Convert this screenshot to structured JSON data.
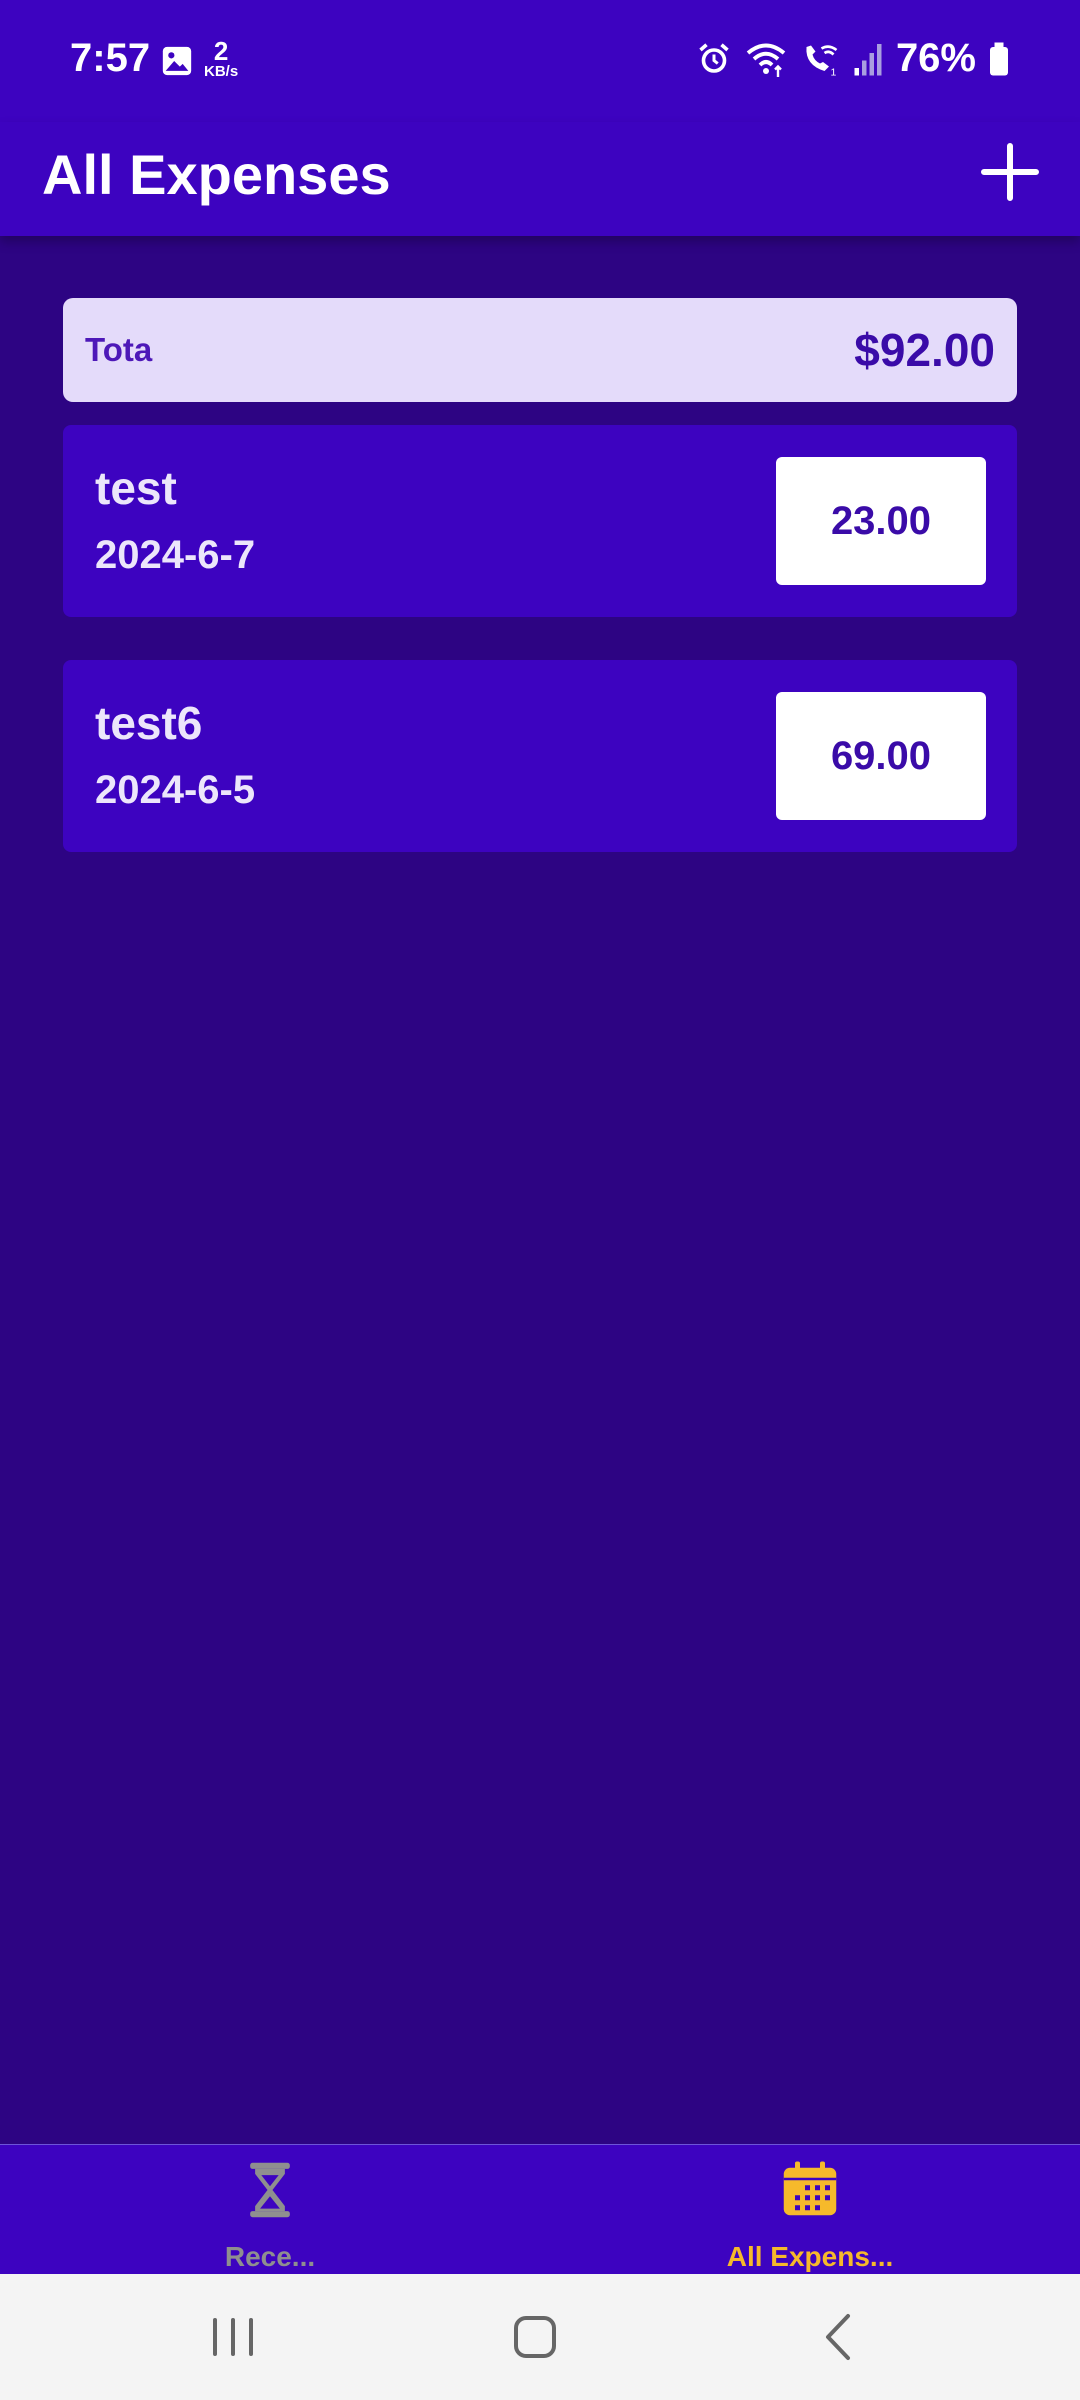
{
  "status_bar": {
    "time": "7:57",
    "net_speed_value": "2",
    "net_speed_unit": "KB/s",
    "battery": "76%",
    "icons": [
      "image-icon",
      "alarm-icon",
      "wifi-icon",
      "wifi-call-icon",
      "signal-icon",
      "battery-icon"
    ]
  },
  "app_bar": {
    "title": "All Expenses",
    "add_icon": "plus-icon"
  },
  "total": {
    "label": "Tota",
    "value": "$92.00"
  },
  "expenses": [
    {
      "title": "test",
      "date": "2024-6-7",
      "amount": "23.00"
    },
    {
      "title": "test6",
      "date": "2024-6-5",
      "amount": "69.00"
    }
  ],
  "bottom_nav": {
    "items": [
      {
        "label": "Rece...",
        "icon": "hourglass-icon",
        "active": false
      },
      {
        "label": "All Expens...",
        "icon": "calendar-icon",
        "active": true
      }
    ]
  },
  "system_nav": {
    "icons": [
      "recents-icon",
      "home-icon",
      "back-icon"
    ]
  },
  "colors": {
    "primary": "#3d03c0",
    "background": "#2d0483",
    "active_tab": "#f6b92b",
    "inactive_tab": "#8f8f8f",
    "total_card": "#e4dbfa"
  }
}
